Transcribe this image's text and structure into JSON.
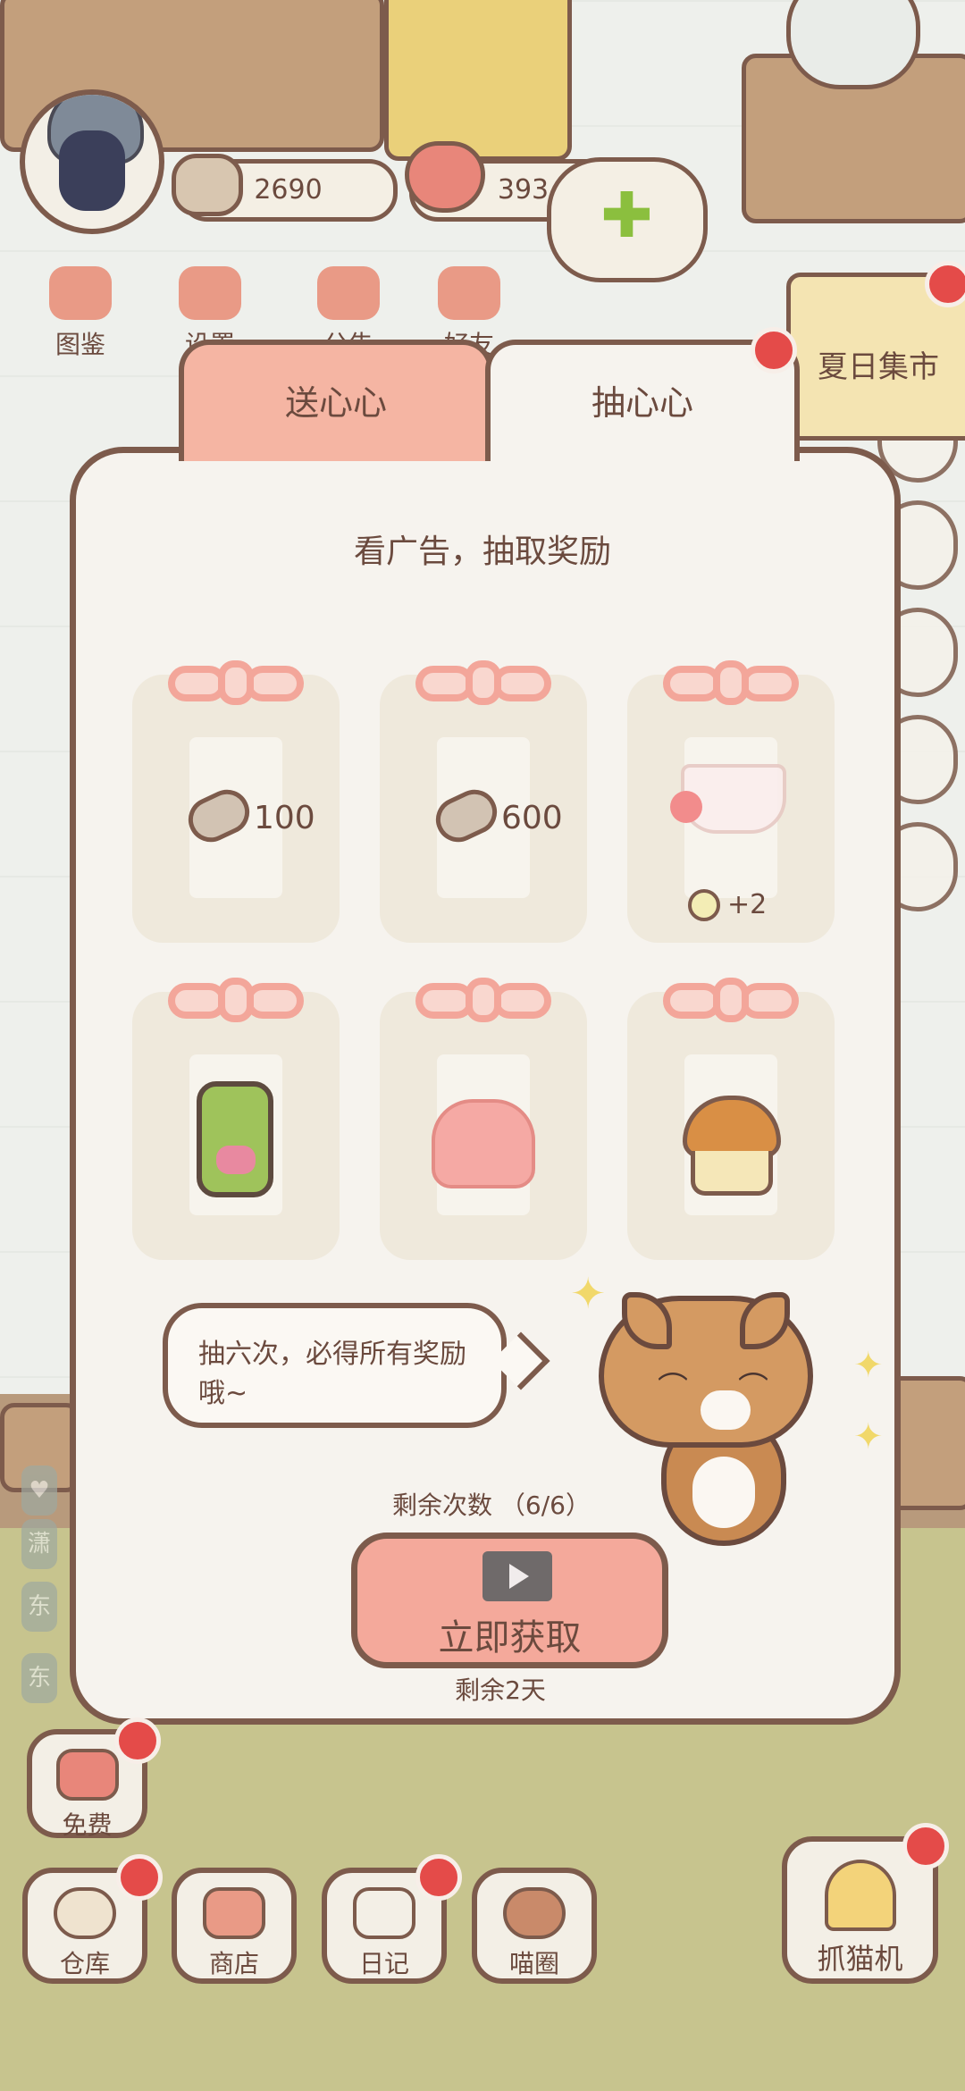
{
  "hud": {
    "fish_count": "2690",
    "heart_count": "393",
    "buttons": [
      {
        "label": "图鉴",
        "icon": "cat-book-icon"
      },
      {
        "label": "设置",
        "icon": "gear-icon"
      },
      {
        "label": "公告",
        "icon": "gift-icon"
      },
      {
        "label": "好友",
        "icon": "friends-icon"
      }
    ],
    "event_label": "夏日集市"
  },
  "dialog": {
    "tabs": [
      {
        "label": "送心心",
        "active": false
      },
      {
        "label": "抽心心",
        "active": true
      }
    ],
    "subtitle": "看广告，抽取奖励",
    "rewards": [
      {
        "icon": "fish-icon",
        "amount": "100"
      },
      {
        "icon": "fish-icon",
        "amount": "600"
      },
      {
        "icon": "teacup-icon",
        "amount": "+2"
      },
      {
        "icon": "cat-can-icon",
        "amount": ""
      },
      {
        "icon": "jelly-icon",
        "amount": ""
      },
      {
        "icon": "muffin-icon",
        "amount": ""
      }
    ],
    "speech": "抽六次，必得所有奖励哦~",
    "remaining_label": "剩余次数 （6/6）",
    "cta_label": "立即获取",
    "days_left": "剩余2天"
  },
  "bottom_bar": {
    "free_label": "免费",
    "items": [
      {
        "label": "仓库",
        "icon": "storage-icon"
      },
      {
        "label": "商店",
        "icon": "shop-icon"
      },
      {
        "label": "日记",
        "icon": "diary-icon"
      },
      {
        "label": "喵圈",
        "icon": "cat-planet-icon"
      }
    ],
    "claw_label": "抓猫机"
  },
  "colors": {
    "accent": "#f4a99b",
    "outline": "#7d5b4c",
    "panel": "#f6f3ee",
    "notification": "#e44b49"
  }
}
